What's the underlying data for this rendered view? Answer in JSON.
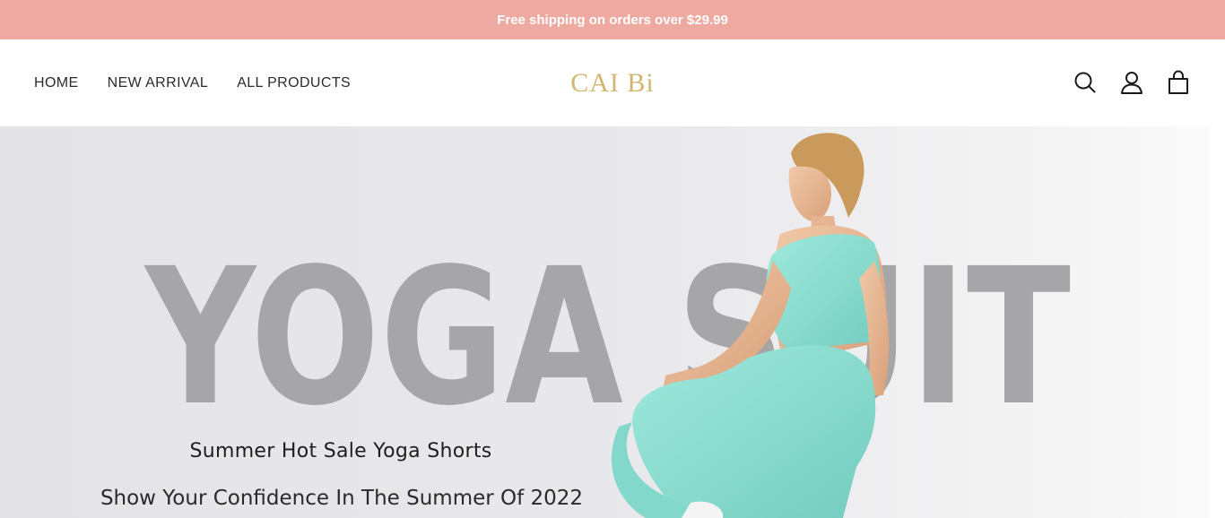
{
  "announcement": {
    "text": "Free shipping on orders over $29.99",
    "background": "#eea9a1"
  },
  "header": {
    "nav": [
      {
        "label": "HOME"
      },
      {
        "label": "NEW ARRIVAL"
      },
      {
        "label": "ALL PRODUCTS"
      }
    ],
    "logo": "CAI Bi",
    "logo_color": "#d2b66f",
    "icons": [
      "search-icon",
      "account-icon",
      "cart-icon"
    ]
  },
  "hero": {
    "big_text": "YOGA SUIT",
    "title": "Summer Hot Sale Yoga Shorts",
    "subtitle": "Show Your Confidence In The Summer Of 2022",
    "big_text_color": "#a6a6a8",
    "outfit_color": "#8fe0d4"
  }
}
